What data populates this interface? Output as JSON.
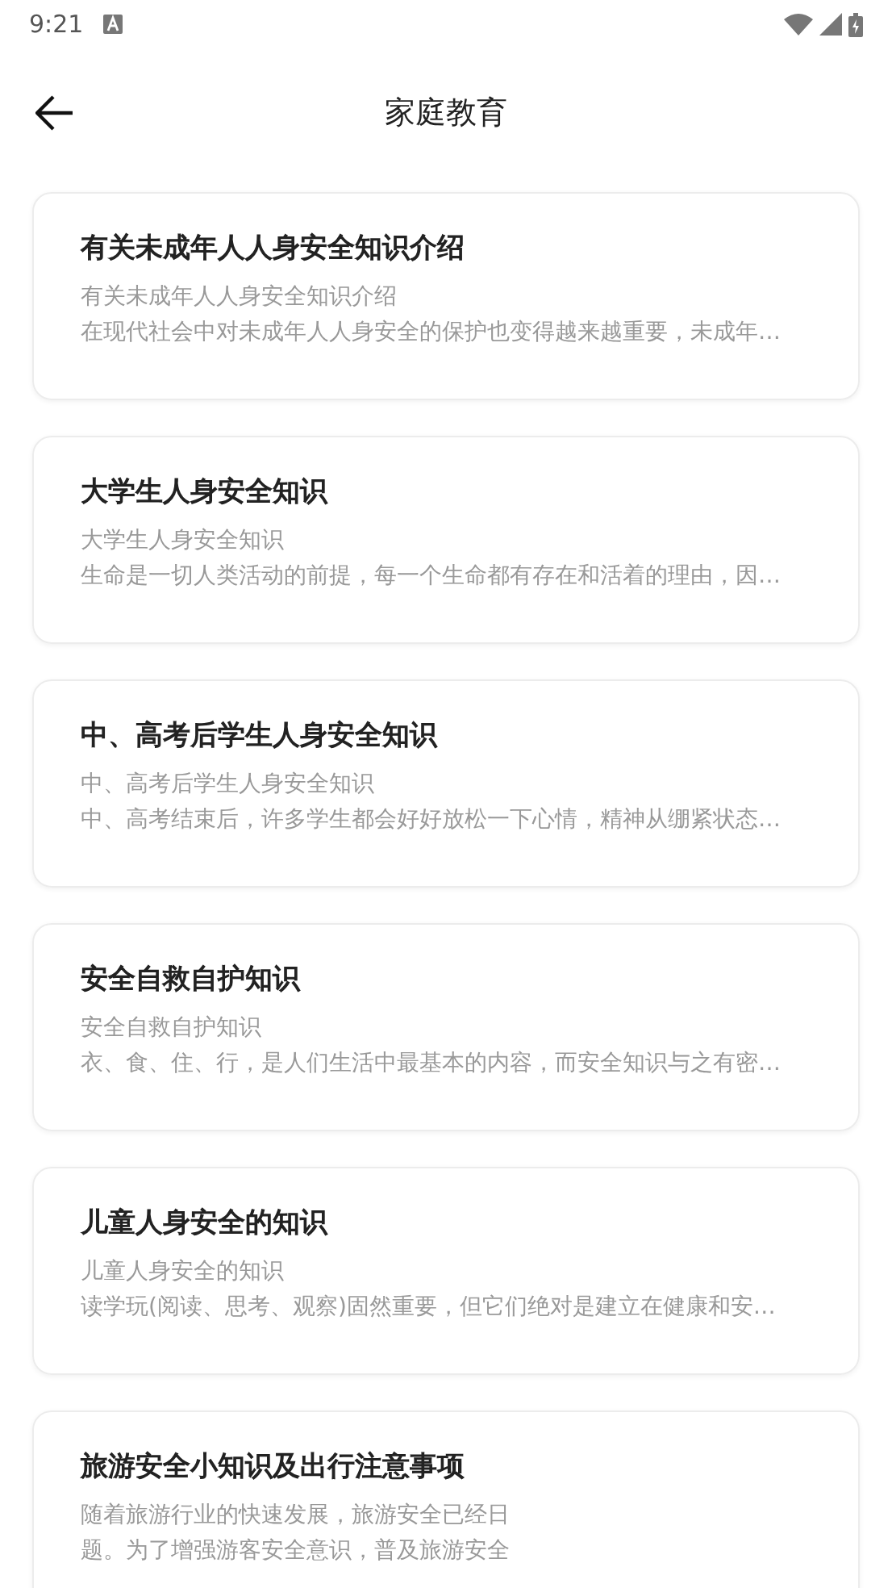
{
  "status_bar": {
    "time": "9:21"
  },
  "header": {
    "title": "家庭教育"
  },
  "articles": [
    {
      "kind": "summary",
      "title": "有关未成年人人身安全知识介绍",
      "subtitle": "有关未成年人人身安全知识介绍",
      "excerpt": [
        "在现代社会中对未成年人人身安全的保护也变得越来越重要，未成年…"
      ]
    },
    {
      "kind": "summary",
      "title": "大学生人身安全知识",
      "subtitle": "大学生人身安全知识",
      "excerpt": [
        "生命是一切人类活动的前提，每一个生命都有存在和活着的理由，因…"
      ]
    },
    {
      "kind": "summary",
      "title": "中、高考后学生人身安全知识",
      "subtitle": "中、高考后学生人身安全知识",
      "excerpt": [
        "中、高考结束后，许多学生都会好好放松一下心情，精神从绷紧状态…"
      ]
    },
    {
      "kind": "summary",
      "title": "安全自救自护知识",
      "subtitle": "安全自救自护知识",
      "excerpt": [
        "衣、食、住、行，是人们生活中最基本的内容，而安全知识与之有密…"
      ]
    },
    {
      "kind": "summary",
      "title": "儿童人身安全的知识",
      "subtitle": "儿童人身安全的知识",
      "excerpt": [
        "读学玩(阅读、思考、观察)固然重要，但它们绝对是建立在健康和安…"
      ]
    },
    {
      "kind": "summary",
      "title": "旅游安全小知识及出行注意事项",
      "excerpt": [
        "随着旅游行业的快速发展，旅游安全已经日",
        "题。为了增强游客安全意识，普及旅游安全"
      ]
    }
  ]
}
